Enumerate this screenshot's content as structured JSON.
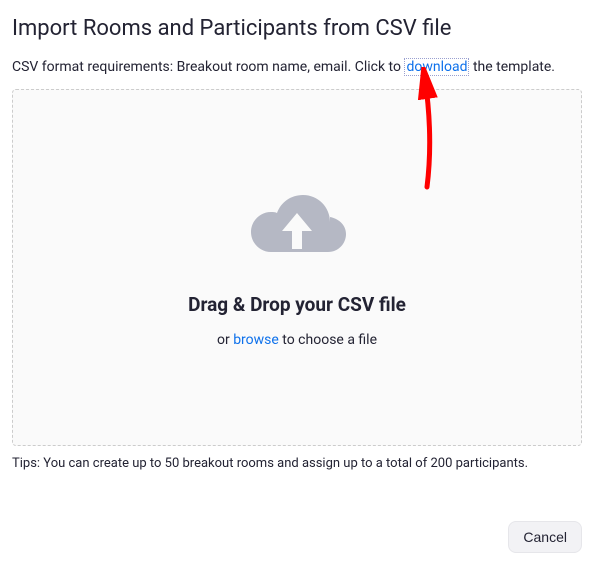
{
  "title": "Import Rooms and Participants from CSV file",
  "subtitle": {
    "prefix": "CSV format requirements: Breakout room name, email. Click to ",
    "link": "download",
    "suffix": " the template."
  },
  "dropzone": {
    "heading": "Drag & Drop your CSV file",
    "or": "or ",
    "browse": "browse",
    "rest": " to choose a file"
  },
  "tips": "Tips: You can create up to 50 breakout rooms and assign up to a total of 200 participants.",
  "buttons": {
    "cancel": "Cancel"
  }
}
